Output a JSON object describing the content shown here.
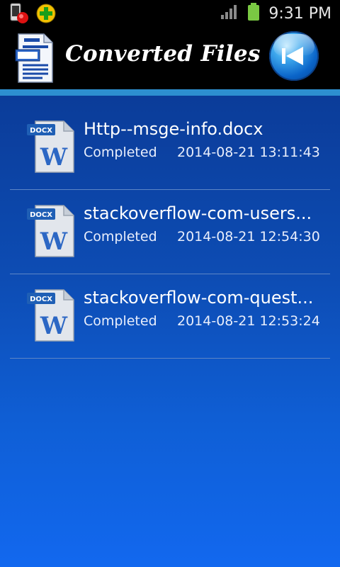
{
  "status_bar": {
    "time": "9:31 PM"
  },
  "header": {
    "title": "Converted Files",
    "back_icon": "skip-back-icon"
  },
  "files": [
    {
      "name": "Http--msge-info.docx",
      "status": "Completed",
      "date": "2014-08-21 13:11:43",
      "badge": "DOCX",
      "letter": "W"
    },
    {
      "name": "stackoverflow-com-users...",
      "status": "Completed",
      "date": "2014-08-21 12:54:30",
      "badge": "DOCX",
      "letter": "W"
    },
    {
      "name": "stackoverflow-com-quest...",
      "status": "Completed",
      "date": "2014-08-21 12:53:24",
      "badge": "DOCX",
      "letter": "W"
    }
  ],
  "colors": {
    "accent": "#2d8fd0",
    "panel_top": "#0b3c99",
    "panel_bottom": "#1268ef"
  }
}
